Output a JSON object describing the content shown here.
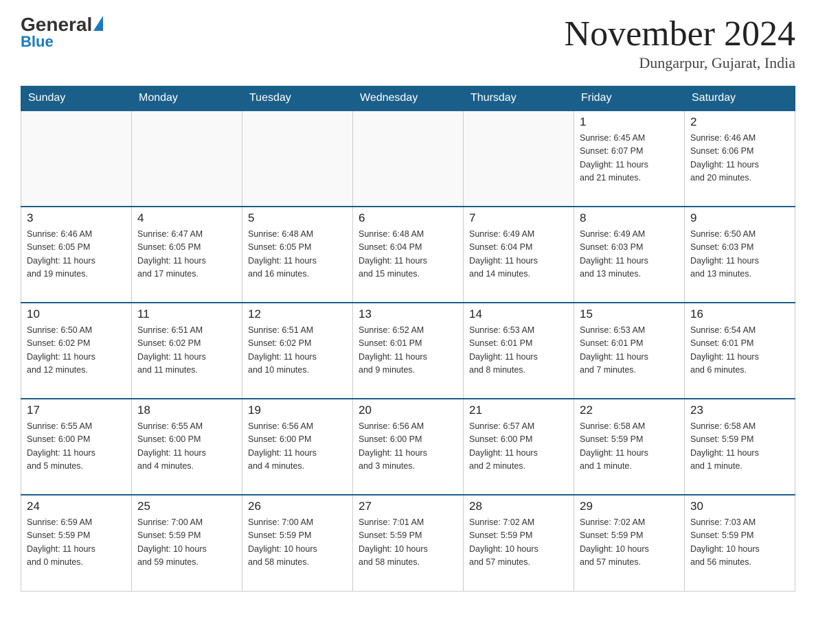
{
  "logo": {
    "general": "General",
    "blue": "Blue",
    "subtitle": "Blue"
  },
  "header": {
    "month_title": "November 2024",
    "location": "Dungarpur, Gujarat, India"
  },
  "weekdays": [
    "Sunday",
    "Monday",
    "Tuesday",
    "Wednesday",
    "Thursday",
    "Friday",
    "Saturday"
  ],
  "weeks": [
    [
      {
        "day": "",
        "info": ""
      },
      {
        "day": "",
        "info": ""
      },
      {
        "day": "",
        "info": ""
      },
      {
        "day": "",
        "info": ""
      },
      {
        "day": "",
        "info": ""
      },
      {
        "day": "1",
        "info": "Sunrise: 6:45 AM\nSunset: 6:07 PM\nDaylight: 11 hours\nand 21 minutes."
      },
      {
        "day": "2",
        "info": "Sunrise: 6:46 AM\nSunset: 6:06 PM\nDaylight: 11 hours\nand 20 minutes."
      }
    ],
    [
      {
        "day": "3",
        "info": "Sunrise: 6:46 AM\nSunset: 6:05 PM\nDaylight: 11 hours\nand 19 minutes."
      },
      {
        "day": "4",
        "info": "Sunrise: 6:47 AM\nSunset: 6:05 PM\nDaylight: 11 hours\nand 17 minutes."
      },
      {
        "day": "5",
        "info": "Sunrise: 6:48 AM\nSunset: 6:05 PM\nDaylight: 11 hours\nand 16 minutes."
      },
      {
        "day": "6",
        "info": "Sunrise: 6:48 AM\nSunset: 6:04 PM\nDaylight: 11 hours\nand 15 minutes."
      },
      {
        "day": "7",
        "info": "Sunrise: 6:49 AM\nSunset: 6:04 PM\nDaylight: 11 hours\nand 14 minutes."
      },
      {
        "day": "8",
        "info": "Sunrise: 6:49 AM\nSunset: 6:03 PM\nDaylight: 11 hours\nand 13 minutes."
      },
      {
        "day": "9",
        "info": "Sunrise: 6:50 AM\nSunset: 6:03 PM\nDaylight: 11 hours\nand 13 minutes."
      }
    ],
    [
      {
        "day": "10",
        "info": "Sunrise: 6:50 AM\nSunset: 6:02 PM\nDaylight: 11 hours\nand 12 minutes."
      },
      {
        "day": "11",
        "info": "Sunrise: 6:51 AM\nSunset: 6:02 PM\nDaylight: 11 hours\nand 11 minutes."
      },
      {
        "day": "12",
        "info": "Sunrise: 6:51 AM\nSunset: 6:02 PM\nDaylight: 11 hours\nand 10 minutes."
      },
      {
        "day": "13",
        "info": "Sunrise: 6:52 AM\nSunset: 6:01 PM\nDaylight: 11 hours\nand 9 minutes."
      },
      {
        "day": "14",
        "info": "Sunrise: 6:53 AM\nSunset: 6:01 PM\nDaylight: 11 hours\nand 8 minutes."
      },
      {
        "day": "15",
        "info": "Sunrise: 6:53 AM\nSunset: 6:01 PM\nDaylight: 11 hours\nand 7 minutes."
      },
      {
        "day": "16",
        "info": "Sunrise: 6:54 AM\nSunset: 6:01 PM\nDaylight: 11 hours\nand 6 minutes."
      }
    ],
    [
      {
        "day": "17",
        "info": "Sunrise: 6:55 AM\nSunset: 6:00 PM\nDaylight: 11 hours\nand 5 minutes."
      },
      {
        "day": "18",
        "info": "Sunrise: 6:55 AM\nSunset: 6:00 PM\nDaylight: 11 hours\nand 4 minutes."
      },
      {
        "day": "19",
        "info": "Sunrise: 6:56 AM\nSunset: 6:00 PM\nDaylight: 11 hours\nand 4 minutes."
      },
      {
        "day": "20",
        "info": "Sunrise: 6:56 AM\nSunset: 6:00 PM\nDaylight: 11 hours\nand 3 minutes."
      },
      {
        "day": "21",
        "info": "Sunrise: 6:57 AM\nSunset: 6:00 PM\nDaylight: 11 hours\nand 2 minutes."
      },
      {
        "day": "22",
        "info": "Sunrise: 6:58 AM\nSunset: 5:59 PM\nDaylight: 11 hours\nand 1 minute."
      },
      {
        "day": "23",
        "info": "Sunrise: 6:58 AM\nSunset: 5:59 PM\nDaylight: 11 hours\nand 1 minute."
      }
    ],
    [
      {
        "day": "24",
        "info": "Sunrise: 6:59 AM\nSunset: 5:59 PM\nDaylight: 11 hours\nand 0 minutes."
      },
      {
        "day": "25",
        "info": "Sunrise: 7:00 AM\nSunset: 5:59 PM\nDaylight: 10 hours\nand 59 minutes."
      },
      {
        "day": "26",
        "info": "Sunrise: 7:00 AM\nSunset: 5:59 PM\nDaylight: 10 hours\nand 58 minutes."
      },
      {
        "day": "27",
        "info": "Sunrise: 7:01 AM\nSunset: 5:59 PM\nDaylight: 10 hours\nand 58 minutes."
      },
      {
        "day": "28",
        "info": "Sunrise: 7:02 AM\nSunset: 5:59 PM\nDaylight: 10 hours\nand 57 minutes."
      },
      {
        "day": "29",
        "info": "Sunrise: 7:02 AM\nSunset: 5:59 PM\nDaylight: 10 hours\nand 57 minutes."
      },
      {
        "day": "30",
        "info": "Sunrise: 7:03 AM\nSunset: 5:59 PM\nDaylight: 10 hours\nand 56 minutes."
      }
    ]
  ]
}
